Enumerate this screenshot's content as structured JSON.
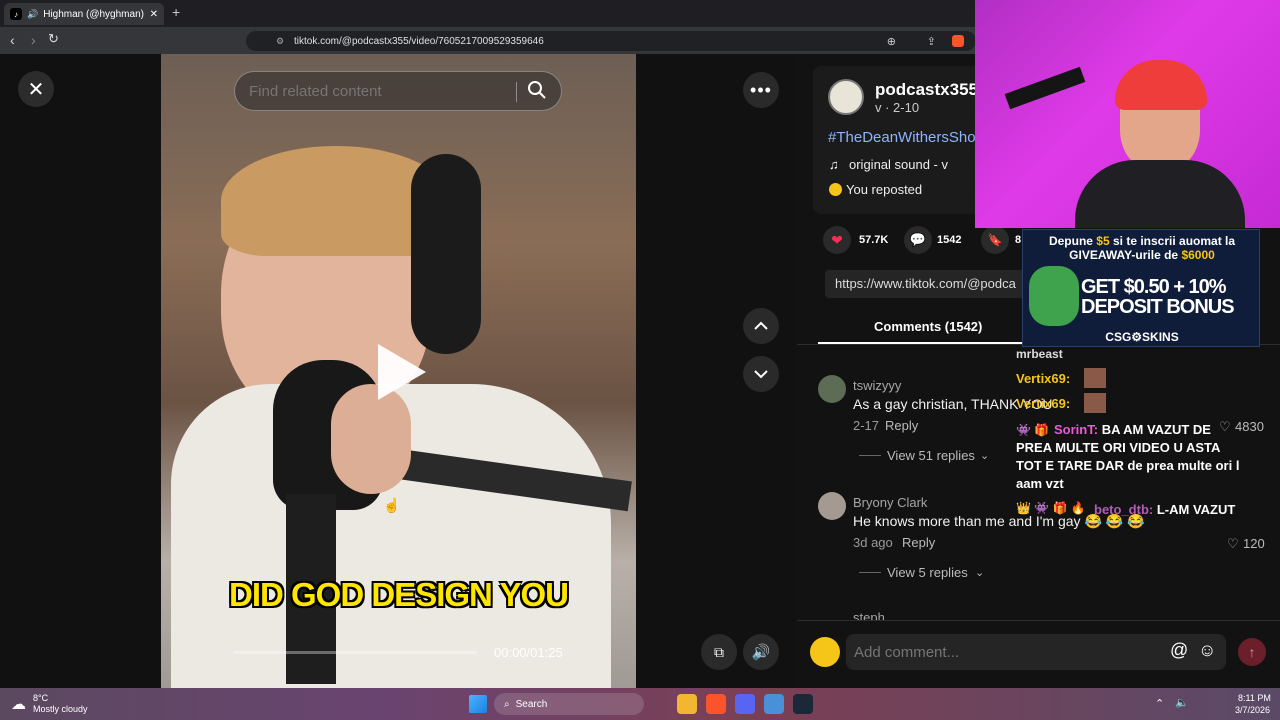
{
  "browser": {
    "tab_title": "Highman (@hyghman) | TikTo",
    "new_tab": "+",
    "url": "tiktok.com/@podcastx355/video/7605217009529359646"
  },
  "search": {
    "placeholder": "Find related content"
  },
  "video": {
    "caption": "DID GOD DESIGN YOU",
    "time": "00:00/01:25",
    "progress": 0.0
  },
  "author": {
    "name": "podcastx355",
    "meta": "v · 2-10",
    "hashtag": "#TheDeanWithersSho",
    "sound": "original sound - v",
    "reposted": "You reposted"
  },
  "actions": {
    "likes": "57.7K",
    "comments": "1542",
    "saves": "8"
  },
  "share_url": "https://www.tiktok.com/@podca",
  "comments_tab": "Comments (1542)",
  "comments": [
    {
      "user": "tswizyyy",
      "text": "As a gay christian, THANK YOU",
      "date": "2-17",
      "reply": "Reply",
      "likes": "4830",
      "view_replies": "View 51 replies"
    },
    {
      "user": "Bryony Clark",
      "text": "He knows more than me and I'm gay 😂 😂 😂",
      "date": "3d ago",
      "reply": "Reply",
      "likes": "120",
      "view_replies": "View 5 replies"
    },
    {
      "user": "steph"
    }
  ],
  "comment_input": {
    "placeholder": "Add comment..."
  },
  "overlay_chat": {
    "partial": "mrbeast",
    "m1_user": "Vertix69:",
    "m2_user": "Vertix69:",
    "m3_user": "SorinT:",
    "m3_text": "BA AM VAZUT DE PREA MULTE ORI VIDEO U ASTA TOT E TARE DAR de prea multe ori l aam vzt",
    "m4_user": "beto_dtb:",
    "m4_text": "L-AM VAZUT"
  },
  "ad": {
    "line1a": "Depune ",
    "line1b": "$5",
    "line1c": " si te inscrii auomat la",
    "line2a": "GIVEAWAY-urile de ",
    "line2b": "$6000",
    "big1": "GET $0.50 + 10%",
    "big2": "DEPOSIT BONUS",
    "brand": "CSG⚙SKINS"
  },
  "taskbar": {
    "temp": "8°C",
    "weather": "Mostly cloudy",
    "search": "Search",
    "time": "8:11 PM",
    "date": "3/7/2026"
  },
  "colors": {
    "like": "#fe2c55",
    "accent": "#e91e63",
    "streamer_bg": "#d020d0"
  }
}
